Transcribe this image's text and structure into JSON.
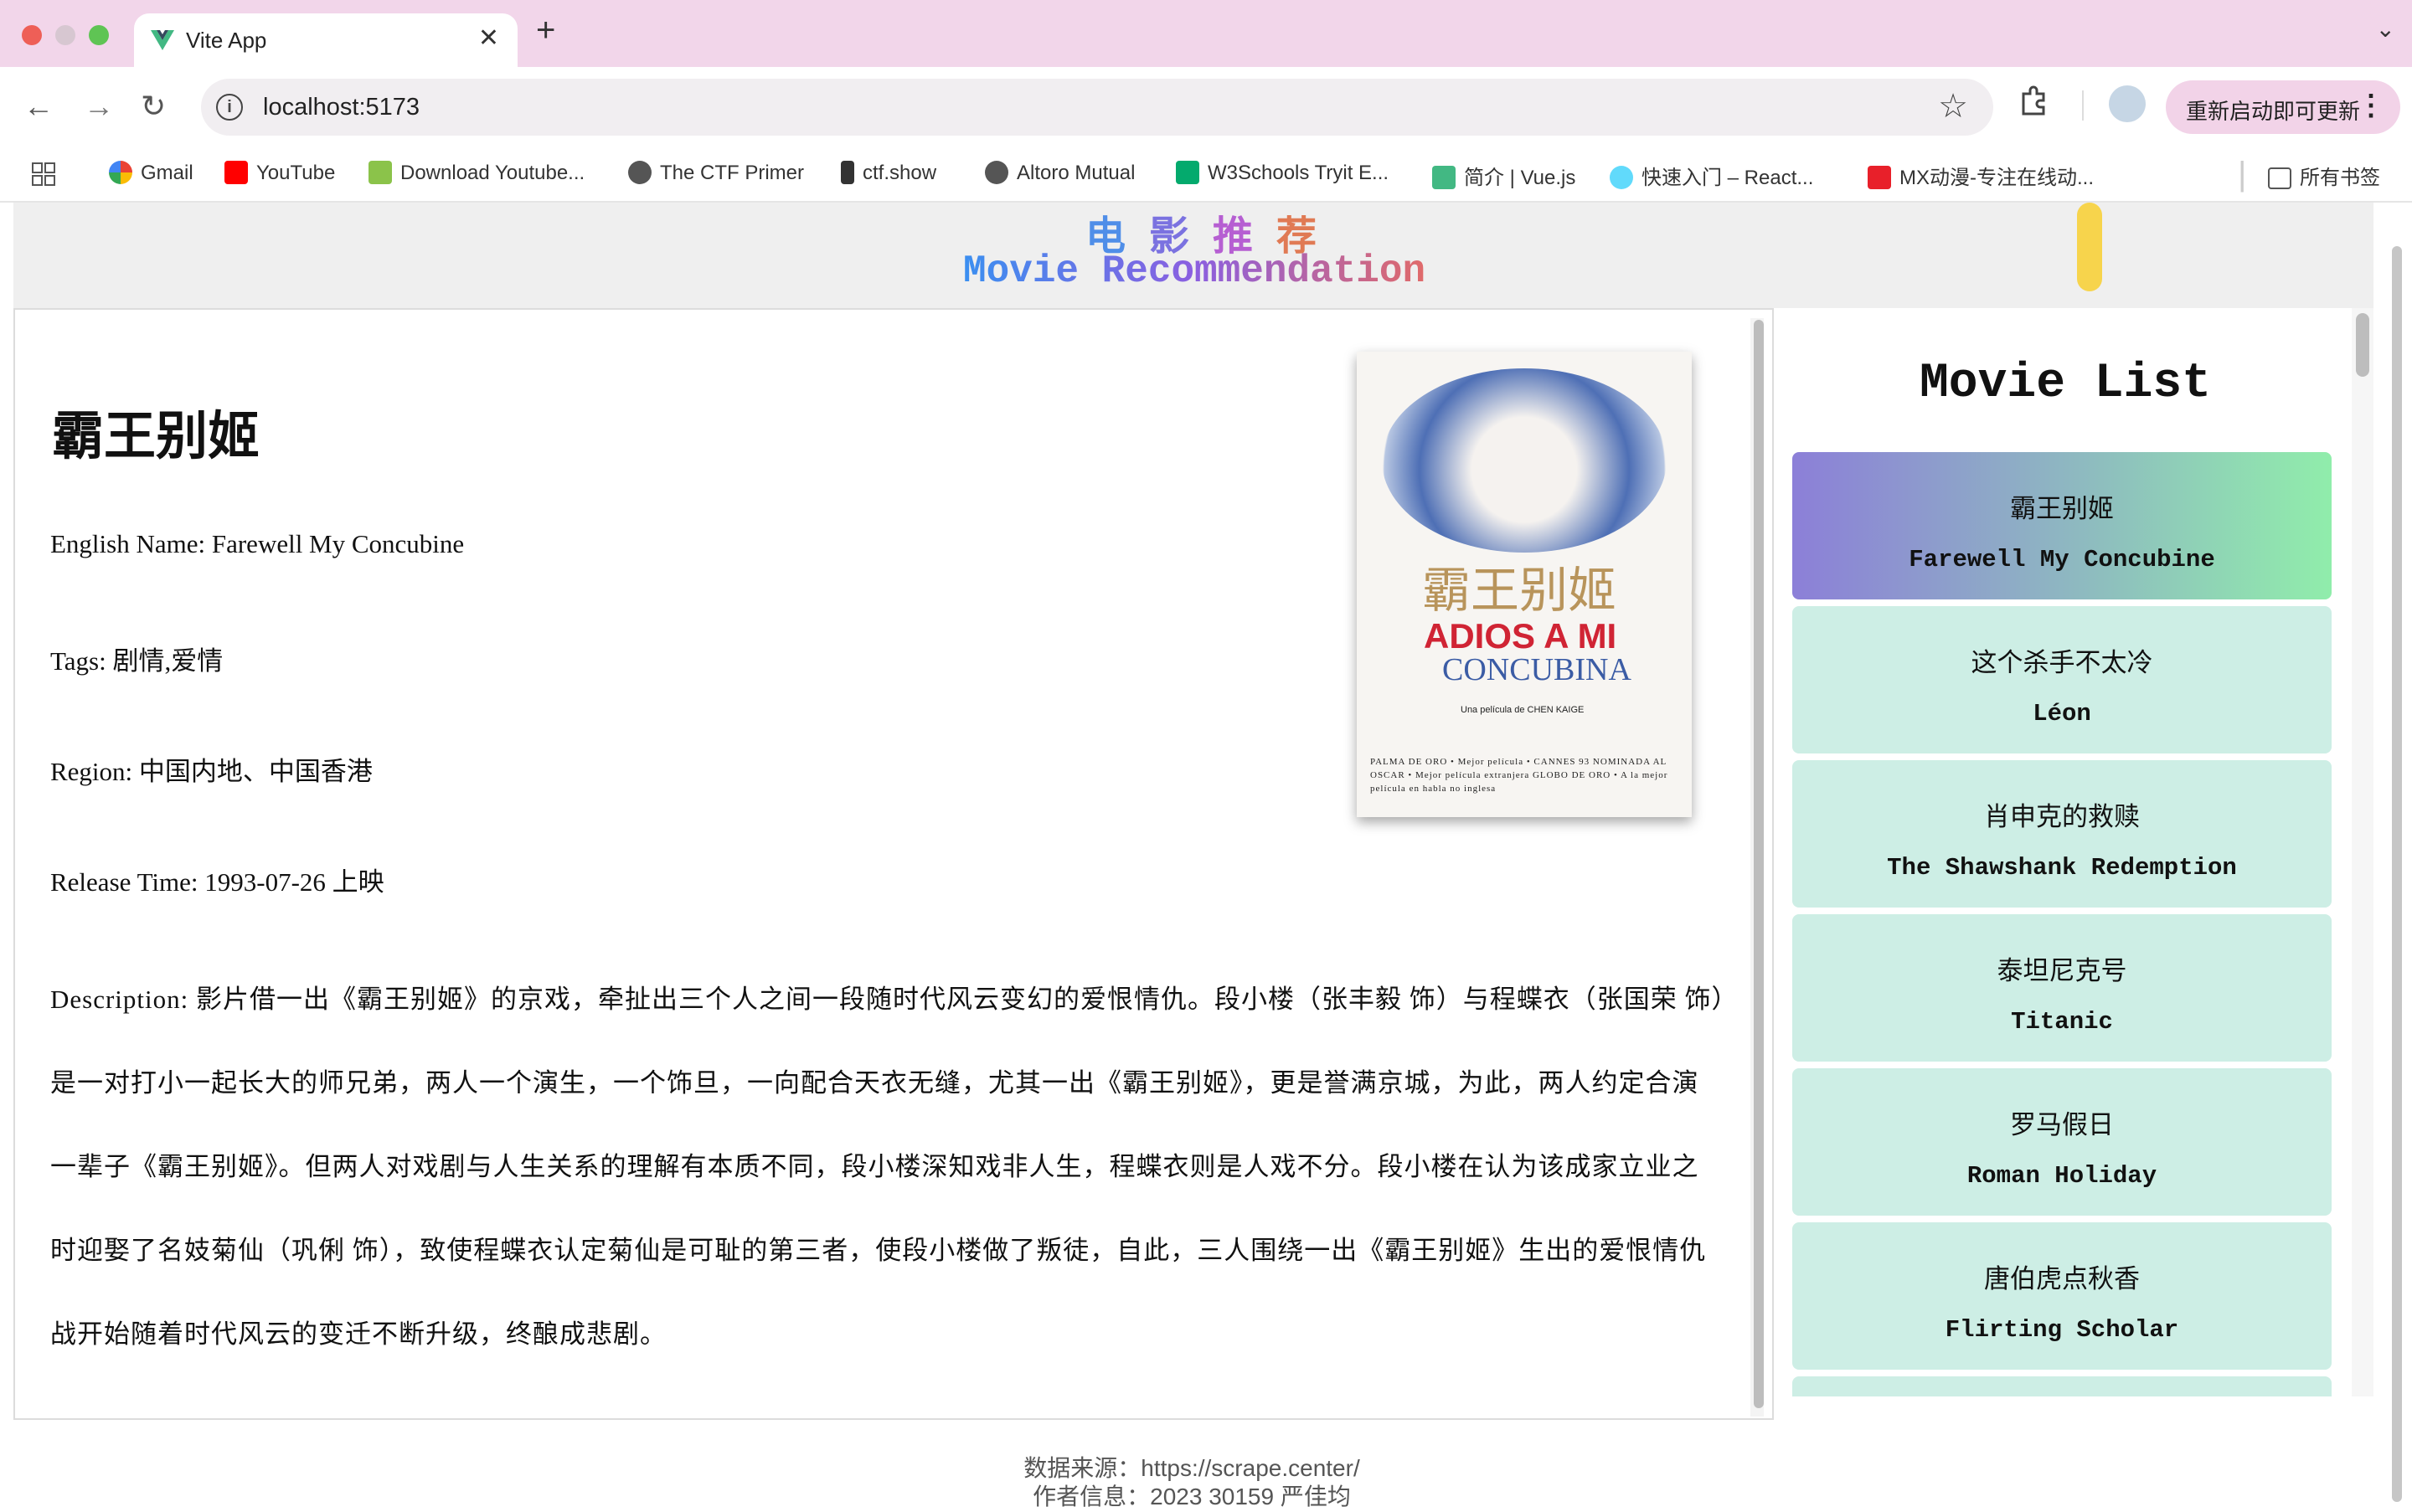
{
  "browser": {
    "tab_title": "Vite App",
    "url": "localhost:5173",
    "update_button": "重新启动即可更新",
    "bookmarks": [
      {
        "label": "Gmail",
        "icon": "gmail-icon"
      },
      {
        "label": "YouTube",
        "icon": "youtube-icon"
      },
      {
        "label": "Download Youtube...",
        "icon": "download-icon"
      },
      {
        "label": "The CTF Primer",
        "icon": "globe-icon"
      },
      {
        "label": "ctf.show",
        "icon": "ctf-icon"
      },
      {
        "label": "Altoro Mutual",
        "icon": "globe-icon"
      },
      {
        "label": "W3Schools Tryit E...",
        "icon": "w3schools-icon"
      },
      {
        "label": "简介 | Vue.js",
        "icon": "vue-icon"
      },
      {
        "label": "快速入门 – React...",
        "icon": "react-icon"
      },
      {
        "label": "MX动漫-专注在线动...",
        "icon": "mx-icon"
      }
    ],
    "all_bookmarks": "所有书签"
  },
  "header": {
    "title_cn_chars": [
      "电",
      "影",
      "推",
      "荐"
    ],
    "title_en": "Movie Recommendation"
  },
  "detail": {
    "name": "霸王别姬",
    "english_name": "English Name: Farewell My Concubine",
    "tags": "Tags: 剧情,爱情",
    "region": "Region: 中国内地、中国香港",
    "release": "Release Time: 1993-07-26 上映",
    "description": "Description: 影片借一出《霸王别姬》的京戏，牵扯出三个人之间一段随时代风云变幻的爱恨情仇。段小楼（张丰毅 饰）与程蝶衣（张国荣 饰）是一对打小一起长大的师兄弟，两人一个演生，一个饰旦，一向配合天衣无缝，尤其一出《霸王别姬》，更是誉满京城，为此，两人约定合演一辈子《霸王别姬》。但两人对戏剧与人生关系的理解有本质不同，段小楼深知戏非人生，程蝶衣则是人戏不分。段小楼在认为该成家立业之时迎娶了名妓菊仙（巩俐 饰），致使程蝶衣认定菊仙是可耻的第三者，使段小楼做了叛徒，自此，三人围绕一出《霸王别姬》生出的爱恨情仇战开始随着时代风云的变迁不断升级，终酿成悲剧。",
    "poster": {
      "cn": "霸王别姬",
      "line1": "ADIOS A MI",
      "line2": "CONCUBINA",
      "credit": "Una película de CHEN KAIGE",
      "awards": "PALMA DE ORO • Mejor película • CANNES 93 NOMINADA AL OSCAR • Mejor película extranjera GLOBO DE ORO • A la mejor película en habla no inglesa"
    }
  },
  "movie_list": {
    "title": "Movie List",
    "items": [
      {
        "cn": "霸王别姬",
        "en": "Farewell My Concubine",
        "active": true
      },
      {
        "cn": "这个杀手不太冷",
        "en": "Léon",
        "active": false
      },
      {
        "cn": "肖申克的救赎",
        "en": "The Shawshank Redemption",
        "active": false
      },
      {
        "cn": "泰坦尼克号",
        "en": "Titanic",
        "active": false
      },
      {
        "cn": "罗马假日",
        "en": "Roman Holiday",
        "active": false
      },
      {
        "cn": "唐伯虎点秋香",
        "en": "Flirting Scholar",
        "active": false
      }
    ]
  },
  "footer": {
    "source": "数据来源：https://scrape.center/",
    "author": "作者信息：2023 30159 严佳均"
  }
}
